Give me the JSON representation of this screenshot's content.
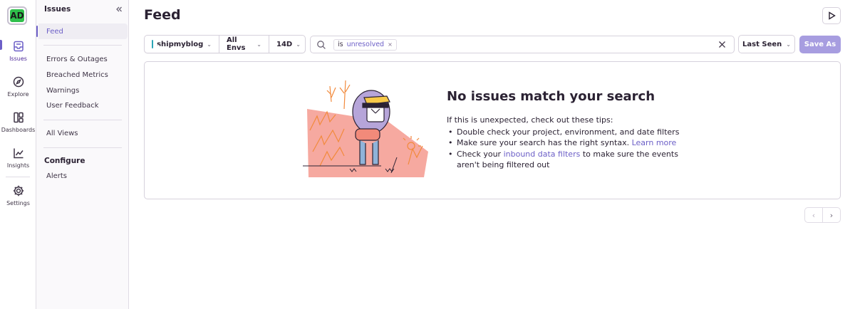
{
  "org": {
    "initials": "AD"
  },
  "rail": {
    "items": [
      {
        "label": "Issues"
      },
      {
        "label": "Explore"
      },
      {
        "label": "Dashboards"
      },
      {
        "label": "Insights"
      },
      {
        "label": "Settings"
      }
    ]
  },
  "subnav": {
    "title": "Issues",
    "items": [
      {
        "label": "Feed"
      },
      {
        "label": "Errors & Outages"
      },
      {
        "label": "Breached Metrics"
      },
      {
        "label": "Warnings"
      },
      {
        "label": "User Feedback"
      },
      {
        "label": "All Views"
      },
      {
        "label": "Alerts"
      }
    ],
    "configure_heading": "Configure"
  },
  "header": {
    "title": "Feed"
  },
  "filters": {
    "project": "shipmyblog",
    "environment": "All Envs",
    "period": "14D"
  },
  "search": {
    "token_key": "is",
    "token_value": "unresolved",
    "token_remove": "×"
  },
  "sort": {
    "label": "Last Seen"
  },
  "save": {
    "label": "Save As"
  },
  "empty": {
    "title": "No issues match your search",
    "intro": "If this is unexpected, check out these tips:",
    "tip1": "Double check your project, environment, and date filters",
    "tip2": "Make sure your search has the right syntax.",
    "tip2_link": "Learn more",
    "tip3_pre": "Check your",
    "tip3_link": "inbound data filters",
    "tip3_post": "to make sure the events aren't being filtered out"
  },
  "pagination": {
    "prev": "‹",
    "next": "›"
  },
  "colors": {
    "accent": "#6c5fc7",
    "save_button": "#a79de0",
    "org_badge": "#2fbf4b",
    "illustration_pink": "#f6a9a0"
  }
}
